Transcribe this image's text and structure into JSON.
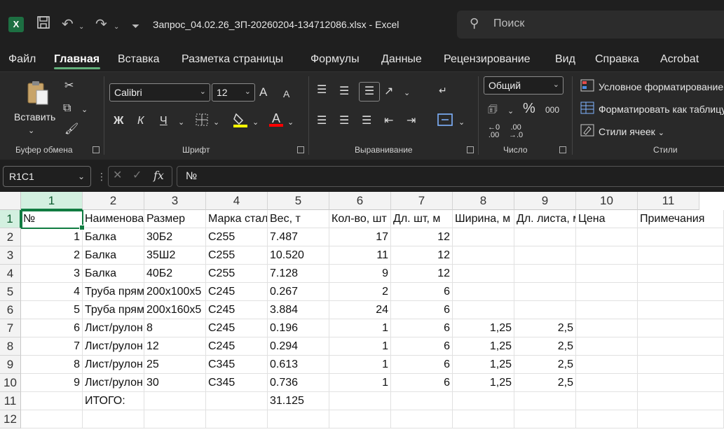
{
  "titlebar": {
    "title": "Запрос_04.02.26_ЗП-20260204-134712086.xlsx  -  Excel",
    "search_placeholder": "Поиск",
    "qat_more": "⏷"
  },
  "tabs": [
    "Файл",
    "Главная",
    "Вставка",
    "Разметка страницы",
    "Формулы",
    "Данные",
    "Рецензирование",
    "Вид",
    "Справка",
    "Acrobat"
  ],
  "ribbon": {
    "clipboard": {
      "paste_label": "Вставить",
      "group_label": "Буфер обмена"
    },
    "font": {
      "font_name": "Calibri",
      "font_size": "12",
      "bold": "Ж",
      "italic": "К",
      "underline": "Ч",
      "grow": "A",
      "shrink": "A",
      "font_color": "A",
      "group_label": "Шрифт"
    },
    "alignment": {
      "group_label": "Выравнивание"
    },
    "number": {
      "format": "Общий",
      "percent": "%",
      "thousands": "000",
      "group_label": "Число"
    },
    "styles": {
      "conditional": "Условное форматирование",
      "format_table": "Форматировать как таблицу",
      "cell_styles": "Стили ячеек",
      "group_label": "Стили"
    },
    "colors": {
      "highlight": "#ffff00",
      "font_color": "#ff0000"
    }
  },
  "formula_bar": {
    "name_box": "R1C1",
    "fx": "fx",
    "value": "№"
  },
  "sheet": {
    "columns": [
      "1",
      "2",
      "3",
      "4",
      "5",
      "6",
      "7",
      "8",
      "9",
      "10",
      "11"
    ],
    "rows": [
      [
        "№",
        "Наименование",
        "Размер",
        "Марка стали",
        "Вес, т",
        "Кол-во, шт",
        "Дл. шт, м",
        "Ширина, м",
        "Дл. листа, м",
        "Цена",
        "Примечания"
      ],
      [
        "1",
        "Балка",
        "30Б2",
        "С255",
        "7.487",
        "17",
        "12",
        "",
        "",
        "",
        ""
      ],
      [
        "2",
        "Балка",
        "35Ш2",
        "С255",
        "10.520",
        "11",
        "12",
        "",
        "",
        "",
        ""
      ],
      [
        "3",
        "Балка",
        "40Б2",
        "С255",
        "7.128",
        "9",
        "12",
        "",
        "",
        "",
        ""
      ],
      [
        "4",
        "Труба прямоугольная",
        "200х100х5",
        "С245",
        "0.267",
        "2",
        "6",
        "",
        "",
        "",
        ""
      ],
      [
        "5",
        "Труба прямоугольная",
        "200х160х5",
        "С245",
        "3.884",
        "24",
        "6",
        "",
        "",
        "",
        ""
      ],
      [
        "6",
        "Лист/рулон",
        "8",
        "С245",
        "0.196",
        "1",
        "6",
        "1,25",
        "2,5",
        "",
        ""
      ],
      [
        "7",
        "Лист/рулон",
        "12",
        "С245",
        "0.294",
        "1",
        "6",
        "1,25",
        "2,5",
        "",
        ""
      ],
      [
        "8",
        "Лист/рулон",
        "25",
        "С345",
        "0.613",
        "1",
        "6",
        "1,25",
        "2,5",
        "",
        ""
      ],
      [
        "9",
        "Лист/рулон",
        "30",
        "С345",
        "0.736",
        "1",
        "6",
        "1,25",
        "2,5",
        "",
        ""
      ],
      [
        "",
        "ИТОГО:",
        "",
        "",
        "31.125",
        "",
        "",
        "",
        "",
        "",
        ""
      ],
      [
        "",
        "",
        "",
        "",
        "",
        "",
        "",
        "",
        "",
        "",
        ""
      ]
    ]
  },
  "colors": {
    "accent": "#107c41",
    "title_bg": "#1f1f1f",
    "ribbon_bg": "#292929"
  }
}
